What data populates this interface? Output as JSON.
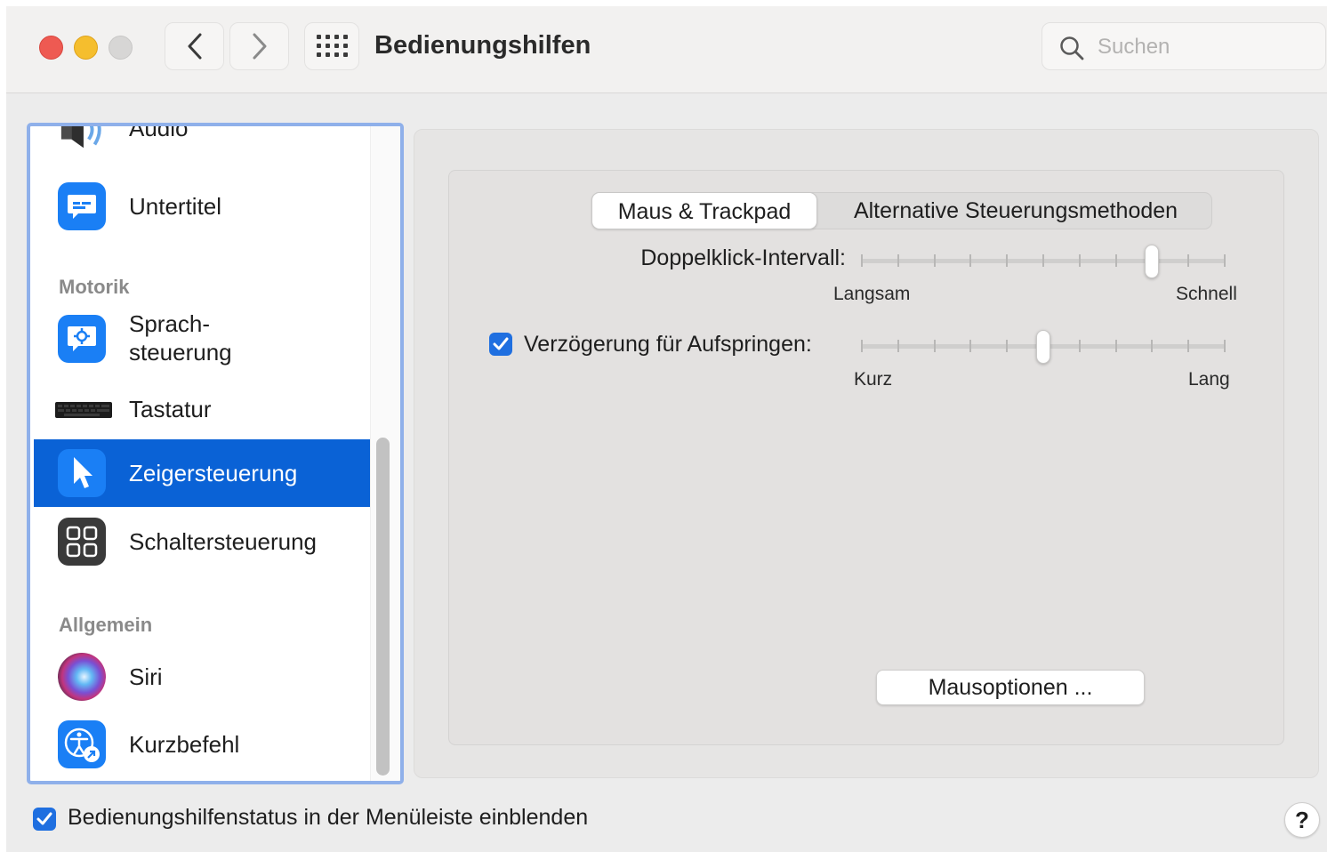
{
  "window": {
    "title": "Bedienungshilfen",
    "search_placeholder": "Suchen"
  },
  "sidebar": {
    "items": [
      {
        "label": "Audio",
        "icon": "speaker-icon"
      },
      {
        "label": "Untertitel",
        "icon": "captions-icon"
      },
      {
        "label": "Sprach-\nsteuerung",
        "line1": "Sprach-",
        "line2": "steuerung",
        "icon": "voice-control-icon"
      },
      {
        "label": "Tastatur",
        "icon": "keyboard-icon"
      },
      {
        "label": "Zeigersteuerung",
        "icon": "pointer-icon",
        "selected": true
      },
      {
        "label": "Schaltersteuerung",
        "icon": "switch-control-icon"
      },
      {
        "label": "Siri",
        "icon": "siri-icon"
      },
      {
        "label": "Kurzbefehl",
        "icon": "accessibility-shortcut-icon"
      }
    ],
    "sections": {
      "motorik": "Motorik",
      "allgemein": "Allgemein"
    }
  },
  "tabs": {
    "active": "Maus & Trackpad",
    "other": "Alternative Steuerungsmethoden"
  },
  "settings": {
    "double_click": {
      "label": "Doppelklick-Intervall:",
      "min_label": "Langsam",
      "max_label": "Schnell",
      "ticks": 11,
      "value_step": 8
    },
    "spring_loading": {
      "label": "Verzögerung für Aufspringen:",
      "checked": true,
      "min_label": "Kurz",
      "max_label": "Lang",
      "ticks": 11,
      "value_step": 5
    },
    "mouse_options_button": "Mausoptionen ..."
  },
  "footer": {
    "show_status_label": "Bedienungshilfenstatus in der Menüleiste einblenden",
    "show_status_checked": true,
    "help_label": "?"
  },
  "colors": {
    "accent": "#0a62d6",
    "checkbox": "#1f6fe0",
    "sidebar_focus_ring": "#8fb0ea"
  }
}
